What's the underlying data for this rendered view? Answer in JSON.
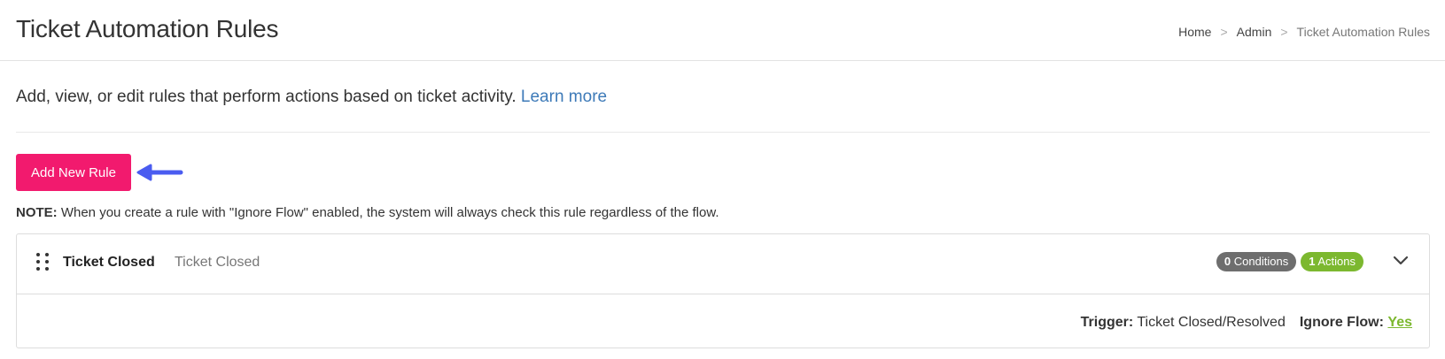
{
  "page": {
    "title": "Ticket Automation Rules"
  },
  "breadcrumb": {
    "items": [
      "Home",
      "Admin",
      "Ticket Automation Rules"
    ],
    "separator": ">"
  },
  "intro": {
    "text": "Add, view, or edit rules that perform actions based on ticket activity.",
    "link": "Learn more"
  },
  "toolbar": {
    "add_label": "Add New Rule"
  },
  "note": {
    "label": "NOTE:",
    "text": " When you create a rule with \"Ignore Flow\" enabled, the system will always check this rule regardless of the flow."
  },
  "rules": [
    {
      "name": "Ticket Closed",
      "description": "Ticket Closed",
      "conditions_count": "0",
      "conditions_label": "Conditions",
      "actions_count": "1",
      "actions_label": "Actions",
      "trigger_label": "Trigger:",
      "trigger_value": "Ticket Closed/Resolved",
      "ignore_flow_label": "Ignore Flow:",
      "ignore_flow_value": "Yes"
    }
  ],
  "icons": {
    "arrow": "arrow-left-icon",
    "drag": "drag-handle-icon",
    "expand": "chevron-down-icon"
  },
  "colors": {
    "primary_button": "#f21a6e",
    "link": "#3d7ab8",
    "arrow": "#4a5cf0",
    "conditions_badge": "#6e6e6e",
    "actions_badge": "#7cb82f"
  }
}
